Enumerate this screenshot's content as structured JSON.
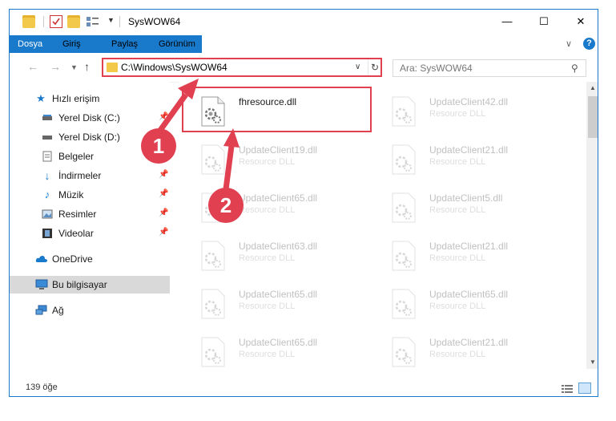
{
  "window": {
    "title": "SysWOW64",
    "controls": {
      "minimize": "—",
      "maximize": "☐",
      "close": "✕"
    }
  },
  "ribbon": {
    "tabs": [
      "Dosya",
      "Giriş",
      "Paylaş",
      "Görünüm"
    ],
    "help": "?"
  },
  "address": {
    "path": "C:\\Windows\\SysWOW64",
    "search_placeholder": "Ara: SysWOW64"
  },
  "sidebar": {
    "items": [
      {
        "label": "Hızlı erişim",
        "icon": "star-icon"
      },
      {
        "label": "Yerel Disk (C:)",
        "icon": "drive-icon"
      },
      {
        "label": "Yerel Disk (D:)",
        "icon": "drive-icon"
      },
      {
        "label": "Belgeler",
        "icon": "documents-icon"
      },
      {
        "label": "İndirmeler",
        "icon": "download-icon"
      },
      {
        "label": "Müzik",
        "icon": "music-icon"
      },
      {
        "label": "Resimler",
        "icon": "pictures-icon"
      },
      {
        "label": "Videolar",
        "icon": "videos-icon"
      },
      {
        "label": "OneDrive",
        "icon": "cloud-icon"
      },
      {
        "label": "Bu bilgisayar",
        "icon": "computer-icon"
      },
      {
        "label": "Ağ",
        "icon": "network-icon"
      }
    ]
  },
  "files": [
    {
      "name": "fhresource.dll",
      "type": ""
    },
    {
      "name": "UpdateClient42.dll",
      "type": "Resource DLL"
    },
    {
      "name": "UpdateClient19.dll",
      "type": "Resource DLL"
    },
    {
      "name": "UpdateClient21.dll",
      "type": "Resource DLL"
    },
    {
      "name": "UpdateClient65.dll",
      "type": "Resource DLL"
    },
    {
      "name": "UpdateClient5.dll",
      "type": "Resource DLL"
    },
    {
      "name": "UpdateClient63.dll",
      "type": "Resource DLL"
    },
    {
      "name": "UpdateClient21.dll",
      "type": "Resource DLL"
    },
    {
      "name": "UpdateClient65.dll",
      "type": "Resource DLL"
    },
    {
      "name": "UpdateClient65.dll",
      "type": "Resource DLL"
    },
    {
      "name": "UpdateClient65.dll",
      "type": "Resource DLL"
    },
    {
      "name": "UpdateClient21.dll",
      "type": "Resource DLL"
    }
  ],
  "status": {
    "count": "139 öğe"
  },
  "callouts": [
    "1",
    "2"
  ],
  "colors": {
    "accent": "#1979ca",
    "highlight": "#e04050",
    "folder": "#f3c94b"
  }
}
